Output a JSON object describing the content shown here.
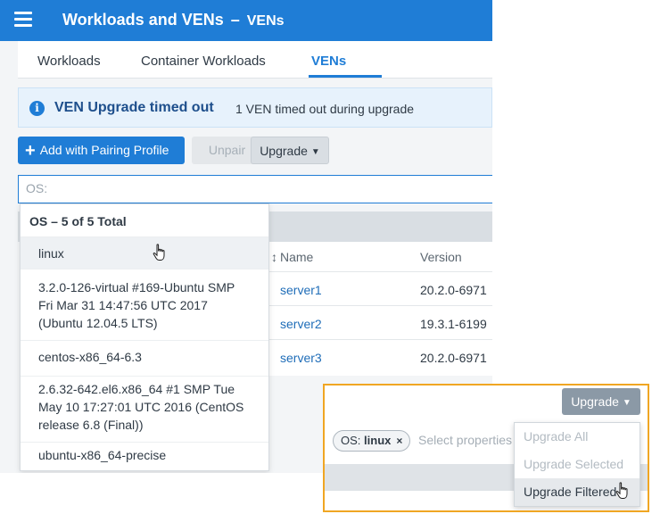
{
  "header": {
    "title": "Workloads and VENs",
    "separator": "–",
    "subtitle": "VENs"
  },
  "tabs": [
    {
      "label": "Workloads"
    },
    {
      "label": "Container Workloads"
    },
    {
      "label": "VENs",
      "active": true
    }
  ],
  "banner": {
    "icon": "info-icon",
    "title": "VEN Upgrade timed out",
    "message": "1 VEN timed out during upgrade"
  },
  "toolbar": {
    "add_label": "Add with Pairing Profile",
    "unpair_label": "Unpair",
    "upgrade_label": "Upgrade"
  },
  "search": {
    "placeholder": "OS:",
    "value": ""
  },
  "dropdown": {
    "header": "OS – 5 of 5 Total",
    "items": [
      "linux",
      "3.2.0-126-virtual #169-Ubuntu SMP Fri Mar 31 14:47:56 UTC 2017 (Ubuntu 12.04.5 LTS)",
      "centos-x86_64-6.3",
      "2.6.32-642.el6.x86_64 #1 SMP Tue May 10 17:27:01 UTC 2016 (CentOS release 6.8 (Final))",
      "ubuntu-x86_64-precise"
    ]
  },
  "table": {
    "columns": [
      "Name",
      "Version"
    ],
    "rows": [
      {
        "name": "server1",
        "version": "20.2.0-6971"
      },
      {
        "name": "server2",
        "version": "19.3.1-6199"
      },
      {
        "name": "server3",
        "version": "20.2.0-6971"
      }
    ]
  },
  "callout": {
    "upgrade_label": "Upgrade",
    "chip_key": "OS:",
    "chip_value": "linux",
    "chip_remove": "×",
    "placeholder": "Select properties",
    "menu": [
      {
        "label": "Upgrade All",
        "enabled": false
      },
      {
        "label": "Upgrade Selected",
        "enabled": false
      },
      {
        "label": "Upgrade Filtered",
        "enabled": true
      }
    ]
  },
  "colors": {
    "primary": "#1f7dd6",
    "highlight_border": "#f0a623",
    "banner_bg": "#e7f2fc"
  }
}
